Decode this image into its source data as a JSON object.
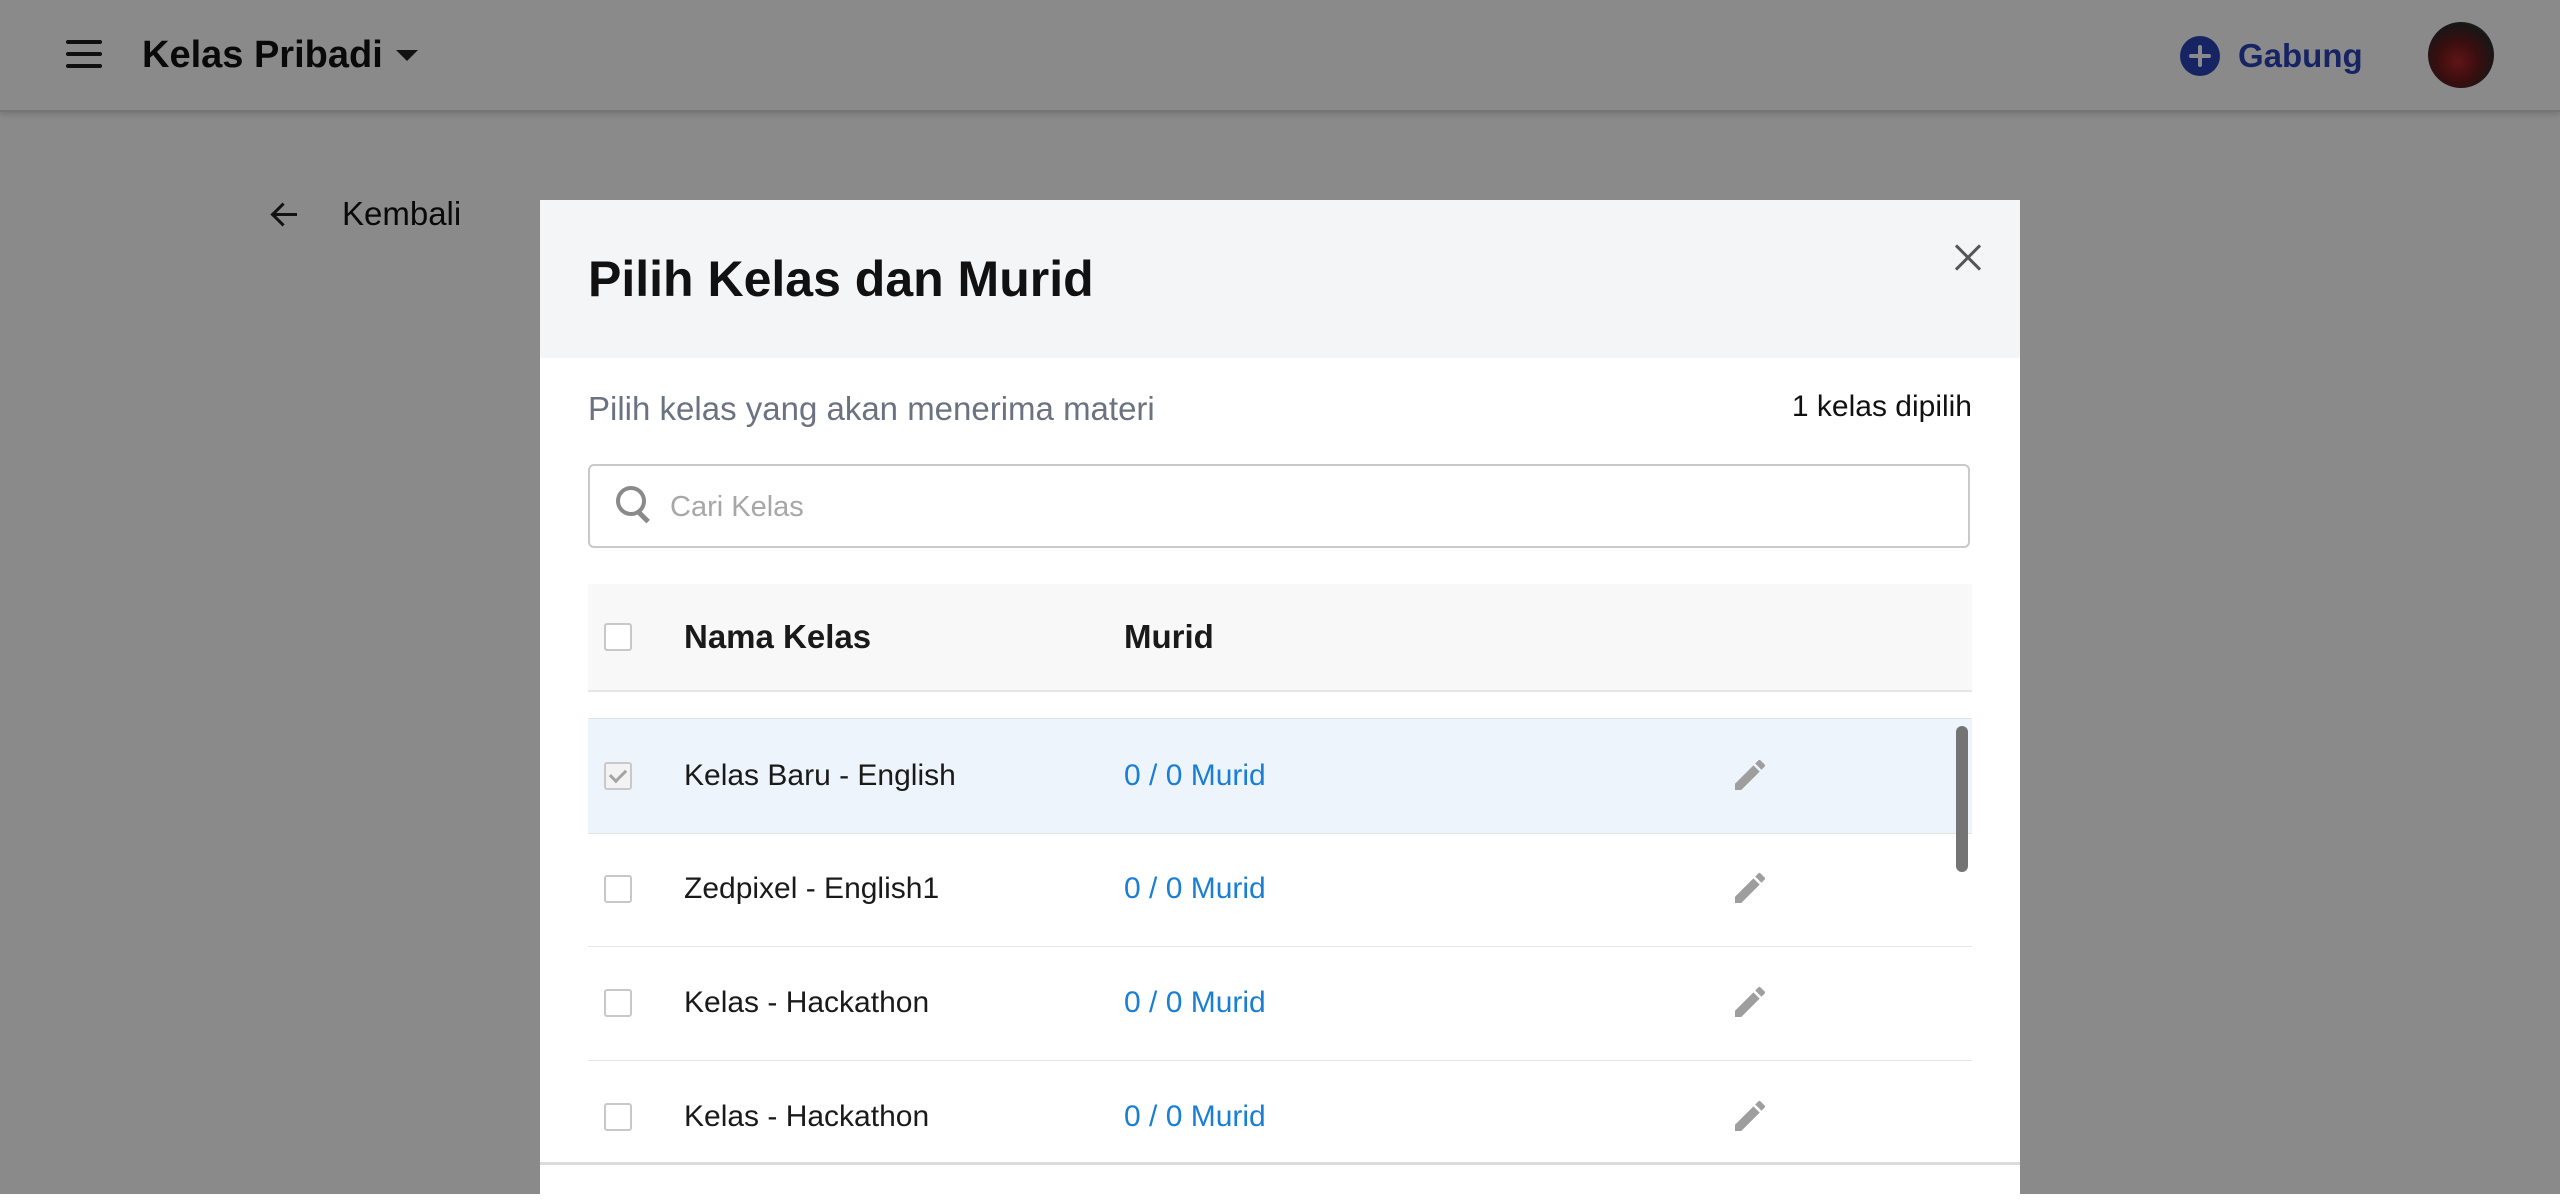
{
  "topbar": {
    "title": "Kelas Pribadi",
    "join_label": "Gabung"
  },
  "page": {
    "back_label": "Kembali"
  },
  "modal": {
    "title": "Pilih Kelas dan Murid",
    "subtitle": "Pilih kelas yang akan menerima materi",
    "selected_count": "1 kelas dipilih",
    "search": {
      "placeholder": "Cari Kelas",
      "value": ""
    },
    "columns": {
      "name": "Nama Kelas",
      "students": "Murid"
    },
    "rows": [
      {
        "name": "Kelas Baru - English",
        "students": "0 / 0 Murid",
        "checked": true
      },
      {
        "name": "Zedpixel - English1",
        "students": "0 / 0 Murid",
        "checked": false
      },
      {
        "name": "Kelas - Hackathon",
        "students": "0 / 0 Murid",
        "checked": false
      },
      {
        "name": "Kelas - Hackathon",
        "students": "0 / 0 Murid",
        "checked": false
      }
    ]
  },
  "colors": {
    "accent": "#2b44b8",
    "link": "#1a7fd4",
    "selected_row": "#eef4fc"
  },
  "icons": [
    "menu-icon",
    "caret-down-icon",
    "plus-circle-icon",
    "avatar",
    "back-arrow-icon",
    "close-icon",
    "search-icon",
    "checkbox",
    "pencil-icon"
  ]
}
